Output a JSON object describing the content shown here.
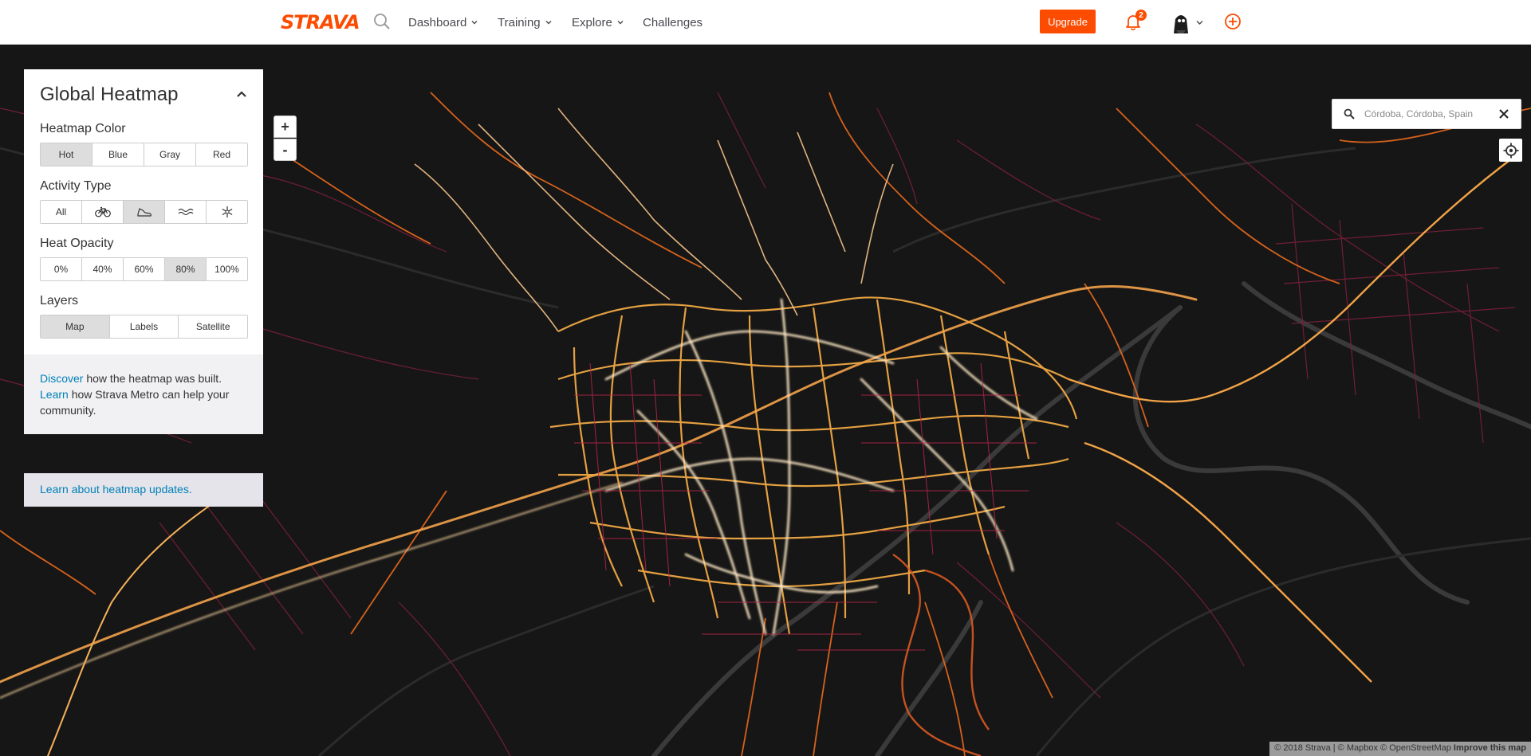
{
  "nav": {
    "logo": "STRAVA",
    "menus": [
      {
        "label": "Dashboard"
      },
      {
        "label": "Training"
      },
      {
        "label": "Explore"
      }
    ],
    "challenges": "Challenges",
    "upgrade": "Upgrade",
    "notification_count": "2",
    "icons": [
      "search-icon",
      "bell-icon",
      "avatar",
      "chevron-down-icon",
      "add-circle-icon"
    ],
    "accent_color": "#fc4c02"
  },
  "panel": {
    "title": "Global Heatmap",
    "heatmap_color": {
      "label": "Heatmap Color",
      "options": [
        "Hot",
        "Blue",
        "Gray",
        "Red"
      ],
      "selected": "Hot"
    },
    "activity_type": {
      "label": "Activity Type",
      "options": [
        "All",
        "bike-icon",
        "run-shoe-icon",
        "water-icon",
        "snowflake-icon"
      ],
      "selected": "run-shoe-icon"
    },
    "heat_opacity": {
      "label": "Heat Opacity",
      "options": [
        "0%",
        "40%",
        "60%",
        "80%",
        "100%"
      ],
      "selected": "80%"
    },
    "layers": {
      "label": "Layers",
      "options": [
        "Map",
        "Labels",
        "Satellite"
      ],
      "selected": "Map"
    },
    "footer": {
      "discover_link": "Discover",
      "discover_text": " how the heatmap was built.",
      "learn_link": "Learn",
      "learn_text": " how Strava Metro can help your community."
    },
    "updates_link": "Learn about heatmap updates."
  },
  "map": {
    "zoom_in": "+",
    "zoom_out": "-",
    "search_placeholder": "Córdoba, Córdoba, Spain",
    "attribution": "© 2018 Strava | © Mapbox © OpenStreetMap ",
    "improve_link": "Improve this map"
  }
}
